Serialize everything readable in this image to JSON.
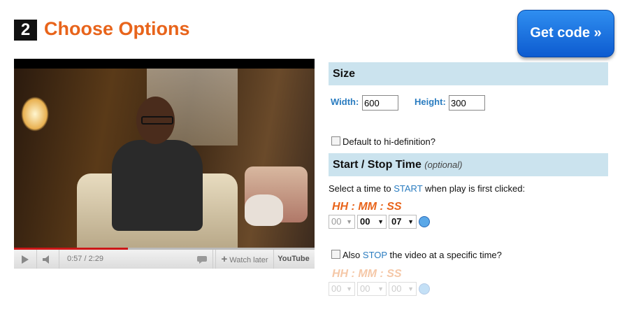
{
  "header": {
    "step_number": "2",
    "title": "Choose Options",
    "get_code_label": "Get code »"
  },
  "player": {
    "time": "0:57 / 2:29",
    "watch_later": "Watch later",
    "logo": "YouTube",
    "progress": 0.38
  },
  "size": {
    "heading": "Size",
    "width_label": "Width:",
    "width_value": "600",
    "height_label": "Height:",
    "height_value": "300",
    "hd_label": "Default to hi-definition?"
  },
  "time": {
    "heading": "Start / Stop Time",
    "optional": "(optional)",
    "start_prefix": "Select a time to ",
    "start_word": "START",
    "start_suffix": " when play is first clicked:",
    "format": "HH : MM : SS",
    "start_hh": "00",
    "start_mm": "00",
    "start_ss": "07",
    "stop_prefix": "Also ",
    "stop_word": "STOP",
    "stop_suffix": " the video at a specific time?",
    "stop_hh": "00",
    "stop_mm": "00",
    "stop_ss": "00"
  },
  "colors": {
    "accent": "#e8641b",
    "link": "#2a7cc0",
    "panel": "#cbe3ee",
    "button": "#1a6fe0"
  }
}
